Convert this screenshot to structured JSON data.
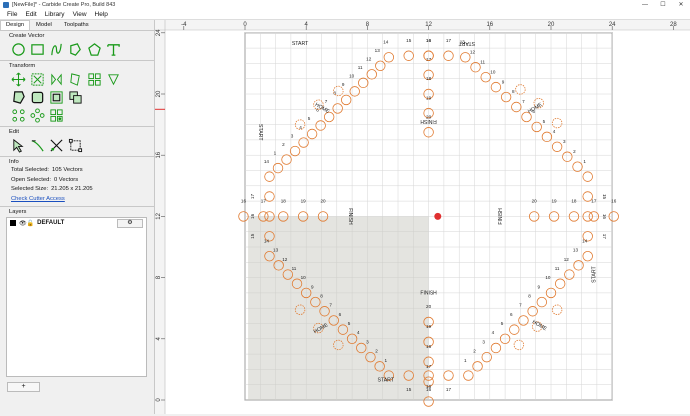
{
  "window": {
    "title": "[NewFile]* - Carbide Create Pro, Build 843",
    "buttons": [
      "—",
      "☐",
      "✕"
    ]
  },
  "menu": [
    "File",
    "Edit",
    "Library",
    "View",
    "Help"
  ],
  "tabs": [
    "Design",
    "Model",
    "Toolpaths"
  ],
  "sections": {
    "create": "Create Vector",
    "transform": "Transform",
    "edit": "Edit",
    "info": "Info",
    "layers": "Layers"
  },
  "info": {
    "total_label": "Total Selected:",
    "total_value": "105 Vectors",
    "open_label": "Open Selected:",
    "open_value": "0 Vectors",
    "size_label": "Selected Size:",
    "size_value": "21.205 x 21.205",
    "cutter_link": "Check Cutter Access"
  },
  "layer": {
    "name": "DEFAULT",
    "gear": "⚙"
  },
  "add_layer": "+",
  "colors": {
    "accent": "#1a9a1a",
    "hole": "#e07a30",
    "grid": "#d6d6d6"
  },
  "ruler": {
    "h_ticks": [
      "-4",
      "0",
      "4",
      "8",
      "12",
      "16",
      "20",
      "24",
      "28"
    ],
    "v_ticks": [
      "24",
      "20",
      "16",
      "12",
      "8",
      "4",
      "0"
    ]
  },
  "board": {
    "tracks": {
      "left": [
        "14",
        "1",
        "2",
        "3",
        "4",
        "5",
        "6",
        "7",
        "8",
        "9",
        "10",
        "11",
        "12",
        "13",
        "14"
      ],
      "top": [
        "13",
        "12",
        "11",
        "10",
        "9",
        "8",
        "7",
        "6",
        "5",
        "4",
        "3",
        "2",
        "1"
      ],
      "right": [
        "14",
        "13",
        "12",
        "11",
        "10",
        "9",
        "8",
        "7",
        "6",
        "5",
        "4",
        "3",
        "2",
        "1"
      ],
      "bottom": [
        "1",
        "2",
        "3",
        "4",
        "5",
        "6",
        "7",
        "8",
        "9",
        "10",
        "11",
        "12",
        "13",
        "14"
      ],
      "center_top": [
        "16",
        "17",
        "18",
        "19",
        "20"
      ],
      "center_left": [
        "20",
        "19",
        "18",
        "17",
        "16"
      ],
      "center_right": [
        "20",
        "19",
        "18",
        "17",
        "16"
      ],
      "center_bottom": [
        "20",
        "19",
        "18",
        "17",
        "16"
      ],
      "top_row": [
        "15",
        "16",
        "17"
      ],
      "bottom_row": [
        "17",
        "16",
        "15"
      ],
      "left_col": [
        "17",
        "16",
        "15"
      ],
      "right_col": [
        "15",
        "16",
        "17"
      ]
    },
    "labels": {
      "start": "START",
      "home": "HOME",
      "finish": "FINISH"
    }
  }
}
